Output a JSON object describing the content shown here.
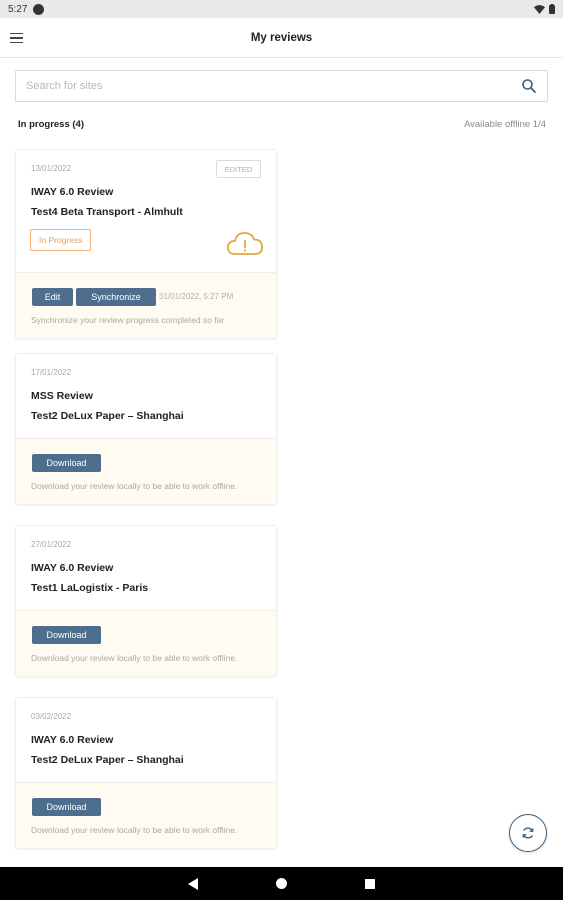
{
  "status_bar": {
    "time": "5:27",
    "app_icon": "g-icon",
    "wifi_icon": "wifi-icon",
    "battery_icon": "battery-icon"
  },
  "app_bar": {
    "title": "My reviews",
    "menu_icon": "hamburger-icon"
  },
  "search": {
    "placeholder": "Search for sites",
    "value": "",
    "icon": "search-icon"
  },
  "section": {
    "title": "In progress (4)",
    "offline": "Available offline 1/4"
  },
  "cards": [
    {
      "date": "13/01/2022",
      "badge": "EDITED",
      "title": "IWAY 6.0 Review",
      "site": "Test4 Beta Transport - Almhult",
      "status": "In Progress",
      "edit_label": "Edit",
      "sync_label": "Synchronize",
      "sync_time": "31/01/2022, 5:27 PM",
      "note": "Synchronize your review progress completed so far",
      "cloud_color": "#e4a83a"
    },
    {
      "date": "17/01/2022",
      "title": "MSS Review",
      "site": "Test2 DeLux Paper – Shanghai",
      "download_label": "Download",
      "note": "Download your review locally to be able to work offline."
    },
    {
      "date": "27/01/2022",
      "title": "IWAY 6.0 Review",
      "site": "Test1 LaLogistix - Paris",
      "download_label": "Download",
      "note": "Download your review locally to be able to work offline."
    },
    {
      "date": "03/02/2022",
      "title": "IWAY 6.0 Review",
      "site": "Test2 DeLux Paper – Shanghai",
      "download_label": "Download",
      "note": "Download your review locally to be able to work offline."
    }
  ],
  "fab": {
    "icon": "refresh-icon"
  },
  "colors": {
    "primary_button": "#4e6e8e",
    "badge_orange": "#e8a060",
    "card_footer": "#fffaf2"
  }
}
